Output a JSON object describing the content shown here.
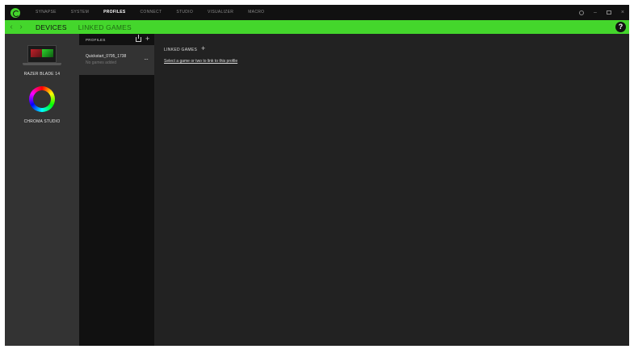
{
  "nav": {
    "tabs": [
      {
        "label": "SYNAPSE",
        "active": false
      },
      {
        "label": "SYSTEM",
        "active": false
      },
      {
        "label": "PROFILES",
        "active": true
      },
      {
        "label": "CONNECT",
        "active": false
      },
      {
        "label": "STUDIO",
        "active": false
      },
      {
        "label": "VISUALIZER",
        "active": false
      },
      {
        "label": "MACRO",
        "active": false
      }
    ],
    "controls": {
      "minimize": "–",
      "close": "×"
    }
  },
  "subnav": {
    "back": "‹",
    "forward": "›",
    "tabs": [
      {
        "label": "DEVICES",
        "active": true
      },
      {
        "label": "LINKED GAMES",
        "active": false
      }
    ],
    "help": "?"
  },
  "devices": [
    {
      "label": "RAZER BLADE 14",
      "icon": "laptop-icon"
    },
    {
      "label": "CHROMA STUDIO",
      "icon": "chroma-ring-icon"
    }
  ],
  "profiles": {
    "title": "PROFILES",
    "add": "+",
    "items": [
      {
        "name": "Quickstart_0795_1738",
        "subtitle": "No games added",
        "more": "···"
      }
    ]
  },
  "linked_games": {
    "title": "LINKED GAMES",
    "add": "+",
    "link_text": "Select a game or two to link to this profile"
  },
  "colors": {
    "accent": "#44d62c",
    "background": "#222222",
    "device_panel": "#333333",
    "profile_panel": "#111111"
  }
}
